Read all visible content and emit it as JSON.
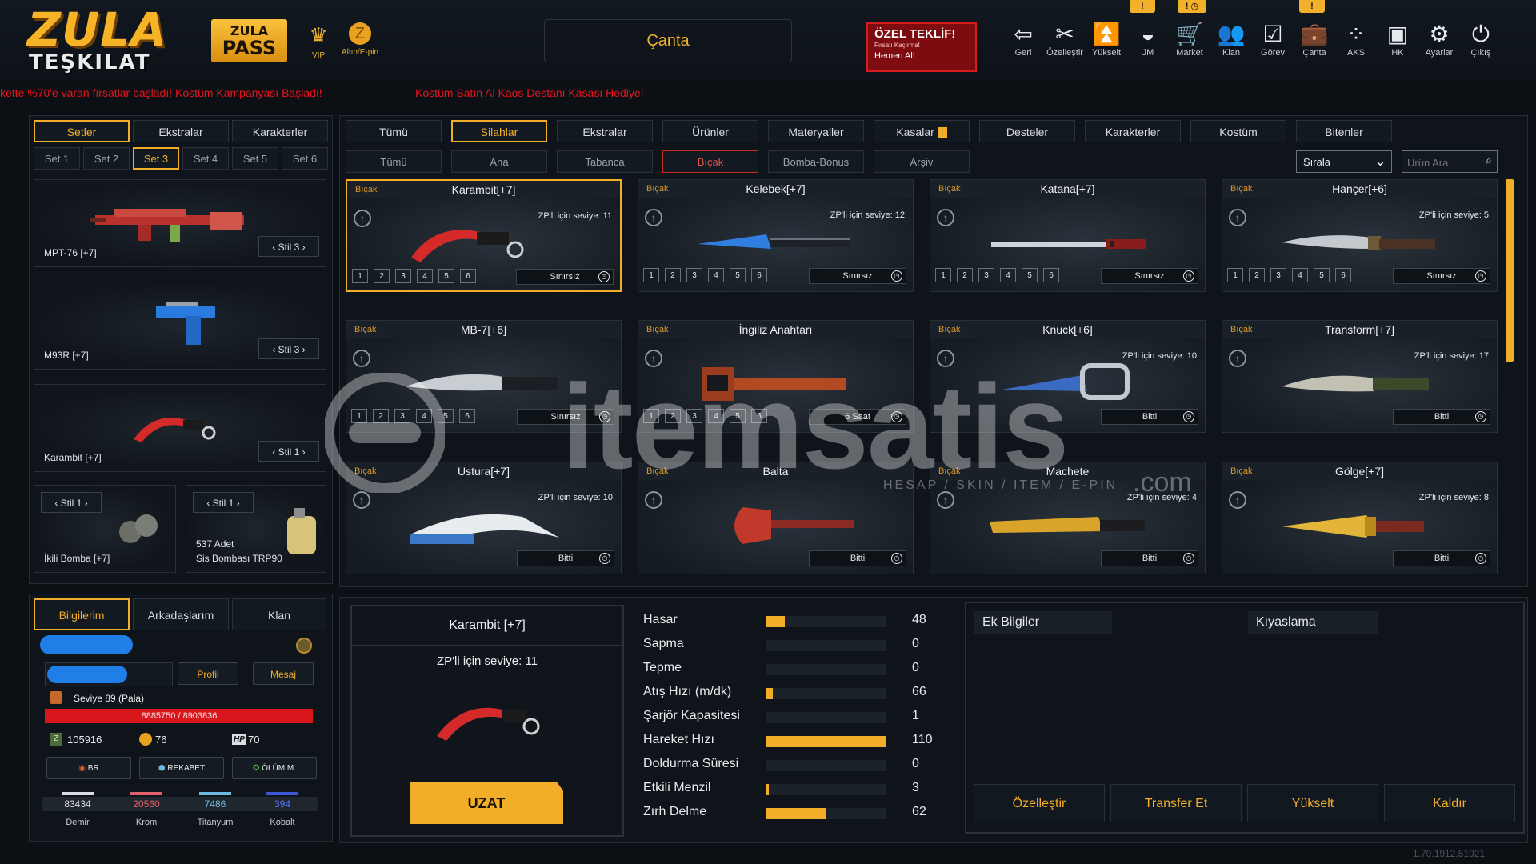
{
  "header": {
    "logo_line1": "ZULA",
    "logo_line2": "TEŞKILAT",
    "pass_line1": "ZULA",
    "pass_line2": "PASS",
    "vip_label": "VIP",
    "gold_label": "Altın/E-pin",
    "window_title": "Çanta",
    "offer": {
      "title": "ÖZEL TEKLİF!",
      "sub": "Fırsatı Kaçırma!",
      "cta": "Hemen Al!"
    },
    "nav": [
      {
        "label": "Geri",
        "icon": "back-icon"
      },
      {
        "label": "Özelleştir",
        "icon": "customize-icon"
      },
      {
        "label": "Yükselt",
        "icon": "upgrade-icon"
      },
      {
        "label": "JM",
        "icon": "jm-icon"
      },
      {
        "label": "Market",
        "icon": "cart-icon"
      },
      {
        "label": "Klan",
        "icon": "clan-icon"
      },
      {
        "label": "Görev",
        "icon": "mission-icon"
      },
      {
        "label": "Çanta",
        "icon": "bag-icon"
      },
      {
        "label": "AKS",
        "icon": "aks-icon"
      },
      {
        "label": "HK",
        "icon": "hk-icon"
      },
      {
        "label": "Ayarlar",
        "icon": "gear-icon"
      },
      {
        "label": "Çıkış",
        "icon": "power-icon"
      }
    ],
    "badges": [
      "!",
      "! ◷",
      "!"
    ],
    "ticker_left": "kette %70'e varan fırsatlar başladı! Kostüm Kampanyası Başladı!",
    "ticker_right": "Kostüm Satın Al Kaos Destanı Kasası Hediye!"
  },
  "left_panel": {
    "tabs": [
      "Setler",
      "Ekstralar",
      "Karakterler"
    ],
    "set_tabs": [
      "Set 1",
      "Set 2",
      "Set 3",
      "Set 4",
      "Set 5",
      "Set 6"
    ],
    "weapons": [
      {
        "name": "MPT-76 [+7]",
        "stil": "Stil 3"
      },
      {
        "name": "M93R [+7]",
        "stil": "Stil 3"
      },
      {
        "name": "Karambit [+7]",
        "stil": "Stil 1"
      }
    ],
    "grenades": [
      {
        "name": "İkili Bomba [+7]",
        "stil": "Stil 1",
        "count": ""
      },
      {
        "name": "Sis Bombası TRP90",
        "stil": "Stil 1",
        "count": "537 Adet"
      }
    ]
  },
  "profile": {
    "tabs": [
      "Bilgilerim",
      "Arkadaşlarım",
      "Klan"
    ],
    "profile_btn": "Profil",
    "message_btn": "Mesaj",
    "level": "Seviye 89 (Pala)",
    "xp": "8885750 / 8903836",
    "xp_fraction": 0.998,
    "zp": "105916",
    "gold": "76",
    "hp": "70",
    "hp_tag": "HP",
    "modes": [
      "BR",
      "REKABET",
      "ÖLÜM M."
    ],
    "resources": [
      {
        "name": "Demir",
        "value": "83434",
        "color": "#d9dde2"
      },
      {
        "name": "Krom",
        "value": "20560",
        "color": "#e0606b"
      },
      {
        "name": "Titanyum",
        "value": "7486",
        "color": "#6fb8e0"
      },
      {
        "name": "Kobalt",
        "value": "394",
        "color": "#3a57d8"
      }
    ]
  },
  "catalog": {
    "tabs": [
      "Tümü",
      "Silahlar",
      "Ekstralar",
      "Ürünler",
      "Materyaller",
      "Kasalar",
      "Desteler",
      "Karakterler",
      "Kostüm",
      "Bitenler"
    ],
    "subtabs": [
      "Tümü",
      "Ana",
      "Tabanca",
      "Bıçak",
      "Bomba-Bonus",
      "Arşiv"
    ],
    "sort_label": "Sırala",
    "search_placeholder": "Ürün Ara",
    "items": [
      {
        "cat": "Bıçak",
        "title": "Karambit[+7]",
        "zp": "ZP'li için seviye: 11",
        "levels": [
          "1",
          "2",
          "3",
          "4",
          "5",
          "6"
        ],
        "duration": "Sınırsız",
        "art": "karambit"
      },
      {
        "cat": "Bıçak",
        "title": "Kelebek[+7]",
        "zp": "ZP'li için seviye: 12",
        "levels": [
          "1",
          "2",
          "3",
          "4",
          "5",
          "6"
        ],
        "duration": "Sınırsız",
        "art": "butterfly"
      },
      {
        "cat": "Bıçak",
        "title": "Katana[+7]",
        "zp": "",
        "levels": [
          "1",
          "2",
          "3",
          "4",
          "5",
          "6"
        ],
        "duration": "Sınırsız",
        "art": "katana"
      },
      {
        "cat": "Bıçak",
        "title": "Hançer[+6]",
        "zp": "ZP'li için seviye: 5",
        "levels": [
          "1",
          "2",
          "3",
          "4",
          "5",
          "6"
        ],
        "duration": "Sınırsız",
        "art": "dagger"
      },
      {
        "cat": "Bıçak",
        "title": "MB-7[+6]",
        "zp": "",
        "levels": [
          "1",
          "2",
          "3",
          "4",
          "5",
          "6"
        ],
        "duration": "Sınırsız",
        "art": "mb7"
      },
      {
        "cat": "Bıçak",
        "title": "İngiliz Anahtarı",
        "zp": "",
        "levels": [
          "1",
          "2",
          "3",
          "4",
          "5",
          "6"
        ],
        "duration": "6 Saat",
        "art": "wrench"
      },
      {
        "cat": "Bıçak",
        "title": "Knuck[+6]",
        "zp": "ZP'li için seviye: 10",
        "levels": [],
        "duration": "Bitti",
        "art": "knuck"
      },
      {
        "cat": "Bıçak",
        "title": "Transform[+7]",
        "zp": "ZP'li için seviye: 17",
        "levels": [],
        "duration": "Bitti",
        "art": "transform"
      },
      {
        "cat": "Bıçak",
        "title": "Ustura[+7]",
        "zp": "ZP'li için seviye: 10",
        "levels": [],
        "duration": "Bitti",
        "art": "razor"
      },
      {
        "cat": "Bıçak",
        "title": "Balta",
        "zp": "",
        "levels": [],
        "duration": "Bitti",
        "art": "axe"
      },
      {
        "cat": "Bıçak",
        "title": "Machete",
        "zp": "ZP'li için seviye: 4",
        "levels": [],
        "duration": "Bitti",
        "art": "machete"
      },
      {
        "cat": "Bıçak",
        "title": "Gölge[+7]",
        "zp": "ZP'li için seviye: 8",
        "levels": [],
        "duration": "Bitti",
        "art": "golge"
      }
    ]
  },
  "details": {
    "title": "Karambit [+7]",
    "zp": "ZP'li için seviye: 11",
    "extend_btn": "UZAT",
    "stats": [
      {
        "label": "Hasar",
        "value": "48",
        "pct": 0.15
      },
      {
        "label": "Sapma",
        "value": "0",
        "pct": 0
      },
      {
        "label": "Tepme",
        "value": "0",
        "pct": 0
      },
      {
        "label": "Atış Hızı (m/dk)",
        "value": "66",
        "pct": 0.05
      },
      {
        "label": "Şarjör Kapasitesi",
        "value": "1",
        "pct": 0
      },
      {
        "label": "Hareket Hızı",
        "value": "110",
        "pct": 1.0
      },
      {
        "label": "Doldurma Süresi",
        "value": "0",
        "pct": 0
      },
      {
        "label": "Etkili Menzil",
        "value": "3",
        "pct": 0.02
      },
      {
        "label": "Zırh Delme",
        "value": "62",
        "pct": 0.5
      }
    ],
    "extra_title": "Ek Bilgiler",
    "compare_title": "Kıyaslama",
    "actions": [
      "Özelleştir",
      "Transfer Et",
      "Yükselt",
      "Kaldır"
    ]
  },
  "watermark": {
    "brand": "itemsatis",
    "tagline": "HESAP / SKIN / ITEM / E-PIN",
    "suffix": ".com"
  },
  "version": "1.70.1912.51921",
  "colors": {
    "accent": "#f2ae29",
    "ticker": "#e8141c",
    "panel": "#0f141a"
  }
}
